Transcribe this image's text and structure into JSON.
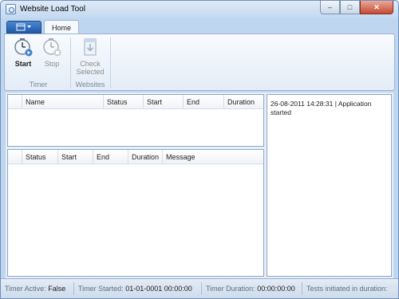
{
  "window": {
    "title": "Website Load Tool"
  },
  "caption": {
    "minimize": "–",
    "maximize": "□",
    "close": "✕"
  },
  "ribbon": {
    "app_menu_icon": "app-menu-icon",
    "tab_home": "Home",
    "timer_group": {
      "label": "Timer",
      "start": {
        "label": "Start",
        "icon": "clock-play-icon"
      },
      "stop": {
        "label": "Stop",
        "icon": "clock-stop-icon"
      }
    },
    "websites_group": {
      "label": "Websites",
      "check_selected": {
        "label_line1": "Check",
        "label_line2": "Selected",
        "icon": "document-arrow-icon"
      }
    }
  },
  "websites_grid": {
    "columns": [
      "Name",
      "Status",
      "Start",
      "End",
      "Duration"
    ]
  },
  "tests_grid": {
    "columns": [
      "Status",
      "Start",
      "End",
      "Duration",
      "Message"
    ]
  },
  "log": {
    "entry_time": "26-08-2011 14:28:31",
    "entry_sep": "|",
    "entry_text": "Application started"
  },
  "status_bar": {
    "timer_active_label": "Timer Active:",
    "timer_active_value": "False",
    "timer_started_label": "Timer Started:",
    "timer_started_value": "01-01-0001 00:00:00",
    "timer_duration_label": "Timer Duration:",
    "timer_duration_value": "00:00:00:00",
    "tests_label": "Tests initiated in duration:"
  }
}
